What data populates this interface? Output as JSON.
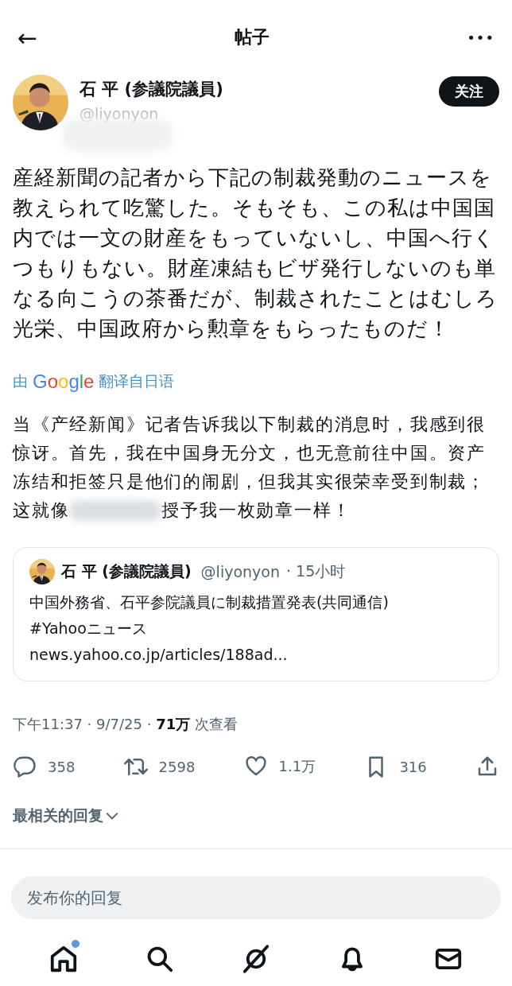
{
  "header": {
    "back": "←",
    "title": "帖子",
    "more": "•••"
  },
  "author": {
    "name": "石 平 (参議院議員)",
    "handle": "@liyonyon",
    "follow": "关注"
  },
  "post_text": "産経新聞の記者から下記の制裁発動のニュースを教えられて吃驚した。そもそも、この私は中国国内では一文の財産をもっていないし、中国へ行くつもりもない。財産凍結もビザ発行しないのも単なる向こうの茶番だが、制裁されたことはむしろ光栄、中国政府から勲章をもらったものだ！",
  "translate_note": {
    "prefix": "由",
    "brand": "Google",
    "suffix": "翻译自日语"
  },
  "translation": {
    "text": "当《产经新闻》记者告诉我以下制裁的消息时，我感到很惊讶。首先，我在中国身无分文，也无意前往中国。资产冻结和拒签只是他们的闹剧，但我其实很荣幸受到制裁；",
    "before_blur": "这就像",
    "after_blur": "授予我一枚勋章一样！"
  },
  "quote": {
    "name": "石 平 (参議院議員)",
    "handle": "@liyonyon",
    "time": "· 15小时",
    "lines": [
      "中国外務省、石平参院議員に制裁措置発表(共同通信)",
      "#Yahooニュース",
      "news.yahoo.co.jp/articles/188ad..."
    ]
  },
  "meta": {
    "time": "下午11:37 · 9/7/25 · ",
    "views": "71万",
    "views_label": " 次查看"
  },
  "actions": [
    {
      "kind": "reply",
      "count": "358"
    },
    {
      "kind": "repost",
      "count": "2598"
    },
    {
      "kind": "like",
      "count": "1.1万"
    },
    {
      "kind": "bookmark",
      "count": "316"
    },
    {
      "kind": "share"
    }
  ],
  "replies_sort": {
    "label": "最相关的回复",
    "expanded": false
  },
  "reply_field": {
    "placeholder": "发布你的回复"
  },
  "nav": [
    {
      "kind": "home",
      "dot": true
    },
    {
      "kind": "search",
      "dot": false
    },
    {
      "kind": "grok",
      "dot": false
    },
    {
      "kind": "bell",
      "dot": false
    },
    {
      "kind": "mail",
      "dot": false
    }
  ]
}
